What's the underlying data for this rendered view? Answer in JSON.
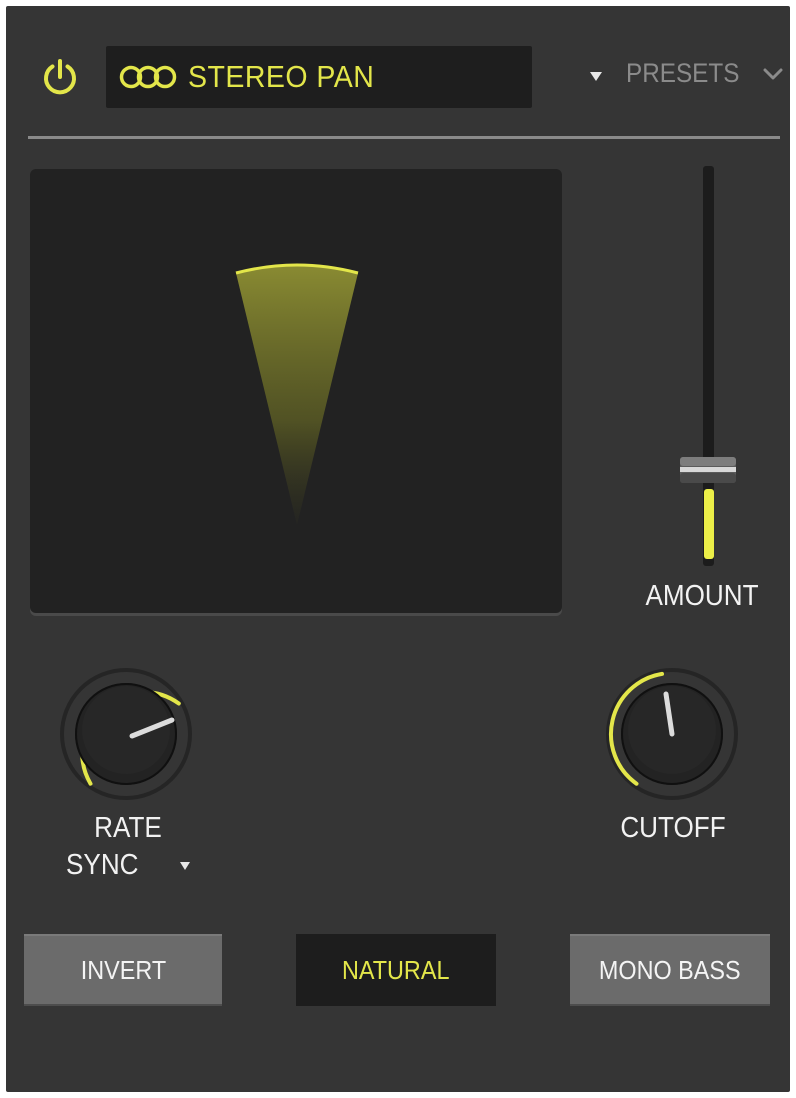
{
  "header": {
    "effect_name": "STEREO PAN",
    "presets_label": "PRESETS",
    "icons": {
      "power": "power-icon",
      "effect": "stereo-pan-icon",
      "dropdown": "triangle-down-icon",
      "presets": "chevron-down-icon"
    }
  },
  "visualizer": {
    "shape": "pan-wedge"
  },
  "amount": {
    "label": "AMOUNT",
    "level": 0.24
  },
  "rate": {
    "label": "RATE",
    "mode_label": "SYNC"
  },
  "cutoff": {
    "label": "CUTOFF"
  },
  "buttons": {
    "invert": "INVERT",
    "natural": "NATURAL",
    "mono_bass": "MONO BASS"
  },
  "colors": {
    "accent": "#e3e64a",
    "panel": "#353535",
    "display_bg": "#222222",
    "button_gray": "#6b6b6b",
    "button_dark": "#1d1d1d"
  }
}
